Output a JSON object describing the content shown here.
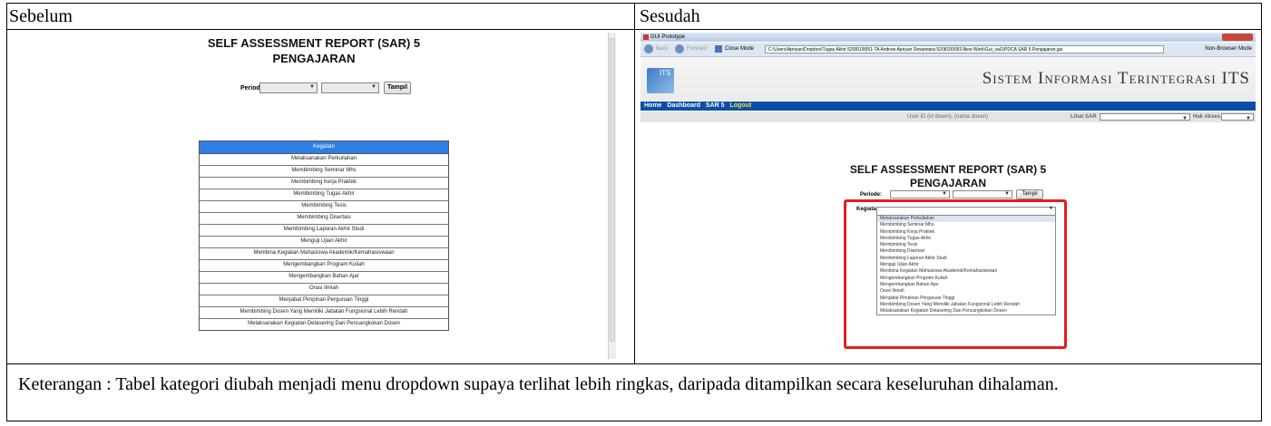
{
  "headers": {
    "before": "Sebelum",
    "after": "Sesudah"
  },
  "left": {
    "title_line1": "SELF ASSESSMENT REPORT (SAR) 5",
    "title_line2": "PENGAJARAN",
    "periode_label": "Periode:",
    "button": "Tampil",
    "table_header": "Kegiatan",
    "items": [
      "Melaksanakan Perkuliahan",
      "Membimbing Seminar Mhs",
      "Membimbing Kerja Praktek",
      "Membimbing Tugas Akhir",
      "Membimbing Tesis",
      "Membimbing Disertasi",
      "Membimbing Laporan Akhir Studi",
      "Menguji Ujian Akhir",
      "Membina Kegiatan Mahasiswa Akademik/Kemahasiswaan",
      "Mengembangkan Program Kuliah",
      "Mengembangkan Bahan Ajar",
      "Orasi Ilmiah",
      "Menjabat Pimpinan Perguruan Tinggi",
      "Membimbing Dosen Yang Memiliki Jabatan Fungsional Lebih Rendah",
      "Melaksanakan Kegiatan Detasering Dan Pencangkokan Dosen"
    ]
  },
  "right": {
    "window_title": "GUI Prototype",
    "nav_back": "Back",
    "nav_forward": "Forward",
    "close_mode": "Close Mode",
    "url": "C:\\Users\\Apriyan\\Dropbox\\Tugas Akhir 5208100051-TA Andrew Apriyan Dewantara 5208100051\\New Work\\Gui_val1\\PDCA SAR 5 Pengajaran.gui",
    "browser_mode": "Non-Browser Mode",
    "logo_text": "ITS",
    "site_title": "Sistem Informasi Terintegrasi ITS",
    "menu": [
      "Home",
      "Dashboard",
      "SAR 5",
      "Logout"
    ],
    "user_info": "User ID (id dosen), (nama dosen)",
    "lihat_sar": "Lihat SAR",
    "hak_akses": "Hak Akses",
    "title_line1": "SELF ASSESSMENT REPORT (SAR) 5",
    "title_line2": "PENGAJARAN",
    "periode_label": "Periode:",
    "button": "Tampil",
    "kegiatan_label": "Kegiatan:",
    "dropdown_items": [
      "Melaksanakan Perkuliahan",
      "Membimbing Seminar Mhs",
      "Membimbing Kerja Praktek",
      "Membimbing Tugas Akhir",
      "Membimbing Tesis",
      "Membimbing Disertasi",
      "Membimbing Laporan Akhir Studi",
      "Menguji Ujian Akhir",
      "Membina Kegiatan Mahasiswa Akademik/Kemahasiswaan",
      "Mengembangkan Program Kuliah",
      "Mengembangkan Bahan Ajar",
      "Orasi Ilmiah",
      "Menjabat Pimpinan Perguruan Tinggi",
      "Membimbing Dosen Yang Memiliki Jabatan Fungsional Lebih Rendah",
      "Melaksanakan Kegiatan Detasering Dan Pencangkokan Dosen"
    ],
    "highlight_color": "#e51d1d"
  },
  "keterangan": "Keterangan : Tabel kategori diubah menjadi menu dropdown supaya terlihat lebih ringkas, daripada ditampilkan secara keseluruhan dihalaman."
}
